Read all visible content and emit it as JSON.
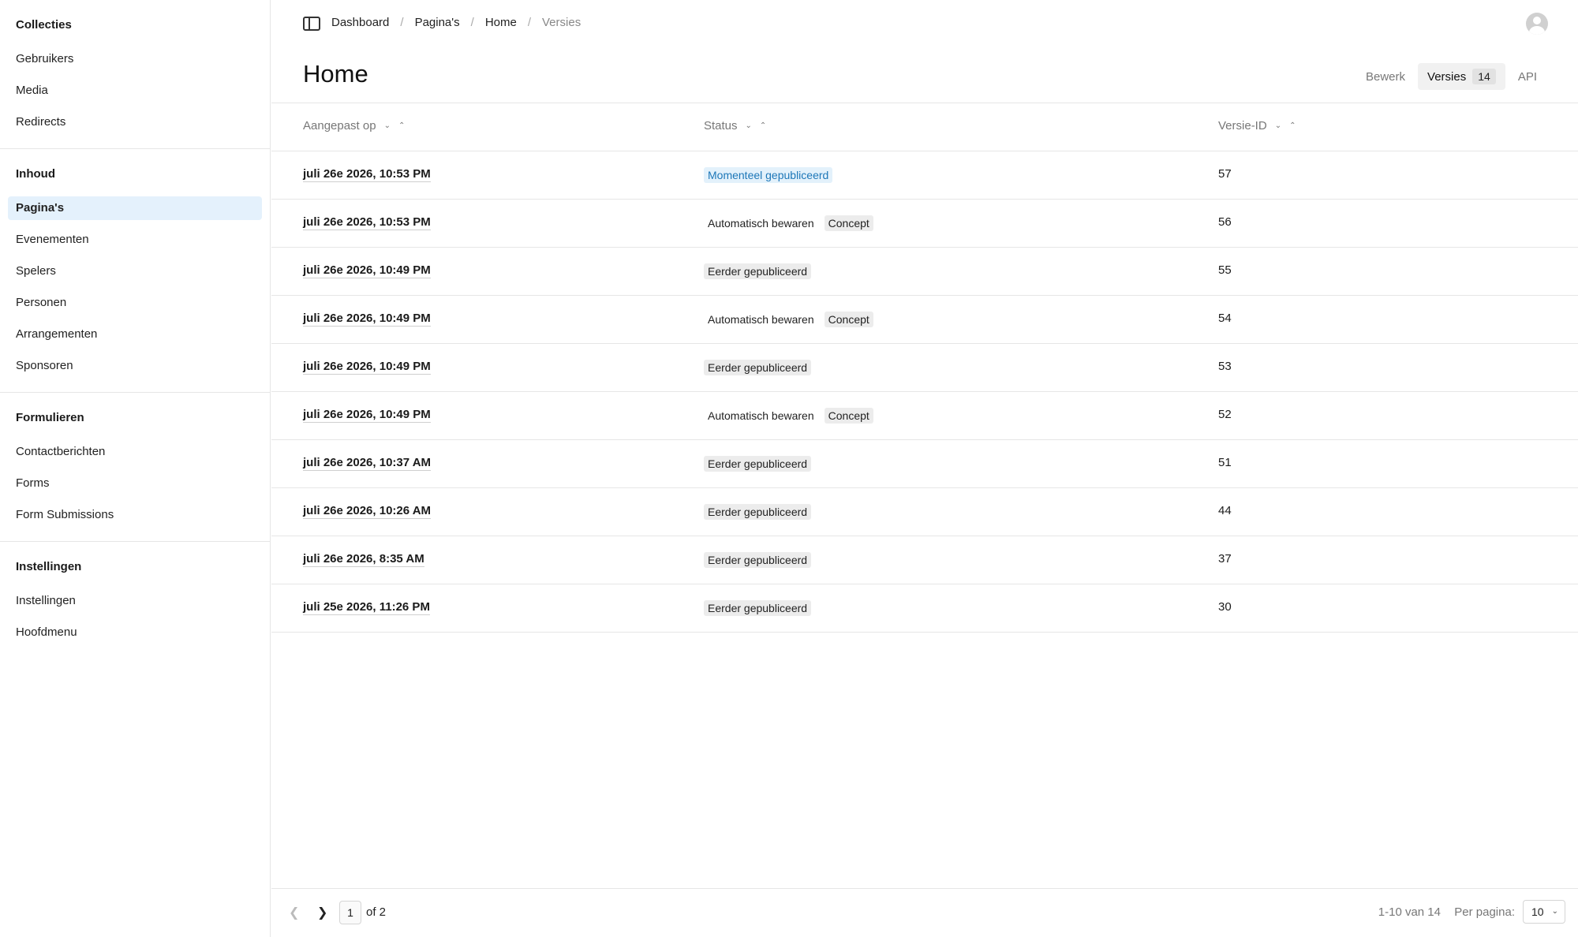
{
  "sidebar": {
    "groups": [
      {
        "title": "Collecties",
        "items": [
          "Gebruikers",
          "Media",
          "Redirects"
        ]
      },
      {
        "title": "Inhoud",
        "items": [
          "Pagina's",
          "Evenementen",
          "Spelers",
          "Personen",
          "Arrangementen",
          "Sponsoren"
        ]
      },
      {
        "title": "Formulieren",
        "items": [
          "Contactberichten",
          "Forms",
          "Form Submissions"
        ]
      },
      {
        "title": "Instellingen",
        "items": [
          "Instellingen",
          "Hoofdmenu"
        ]
      }
    ],
    "active_item": "Pagina's"
  },
  "breadcrumb": [
    "Dashboard",
    "Pagina's",
    "Home",
    "Versies"
  ],
  "page": {
    "title": "Home",
    "tabs": {
      "edit": "Bewerk",
      "versions": "Versies",
      "versions_count": "14",
      "api": "API"
    }
  },
  "table": {
    "headers": {
      "modified": "Aangepast op",
      "status": "Status",
      "version_id": "Versie-ID"
    },
    "rows": [
      {
        "date": "juli 26e 2026, 10:53 PM",
        "status": "Momenteel gepubliceerd",
        "status_type": "published",
        "concept": "",
        "id": "57"
      },
      {
        "date": "juli 26e 2026, 10:53 PM",
        "status": "Automatisch bewaren",
        "status_type": "autosave",
        "concept": "Concept",
        "id": "56"
      },
      {
        "date": "juli 26e 2026, 10:49 PM",
        "status": "Eerder gepubliceerd",
        "status_type": "previous",
        "concept": "",
        "id": "55"
      },
      {
        "date": "juli 26e 2026, 10:49 PM",
        "status": "Automatisch bewaren",
        "status_type": "autosave",
        "concept": "Concept",
        "id": "54"
      },
      {
        "date": "juli 26e 2026, 10:49 PM",
        "status": "Eerder gepubliceerd",
        "status_type": "previous",
        "concept": "",
        "id": "53"
      },
      {
        "date": "juli 26e 2026, 10:49 PM",
        "status": "Automatisch bewaren",
        "status_type": "autosave",
        "concept": "Concept",
        "id": "52"
      },
      {
        "date": "juli 26e 2026, 10:37 AM",
        "status": "Eerder gepubliceerd",
        "status_type": "previous",
        "concept": "",
        "id": "51"
      },
      {
        "date": "juli 26e 2026, 10:26 AM",
        "status": "Eerder gepubliceerd",
        "status_type": "previous",
        "concept": "",
        "id": "44"
      },
      {
        "date": "juli 26e 2026, 8:35 AM",
        "status": "Eerder gepubliceerd",
        "status_type": "previous",
        "concept": "",
        "id": "37"
      },
      {
        "date": "juli 25e 2026, 11:26 PM",
        "status": "Eerder gepubliceerd",
        "status_type": "previous",
        "concept": "",
        "id": "30"
      }
    ]
  },
  "pagination": {
    "current_page": "1",
    "of_label": "of 2",
    "range": "1-10 van 14",
    "per_page_label": "Per pagina:",
    "per_page_value": "10"
  }
}
